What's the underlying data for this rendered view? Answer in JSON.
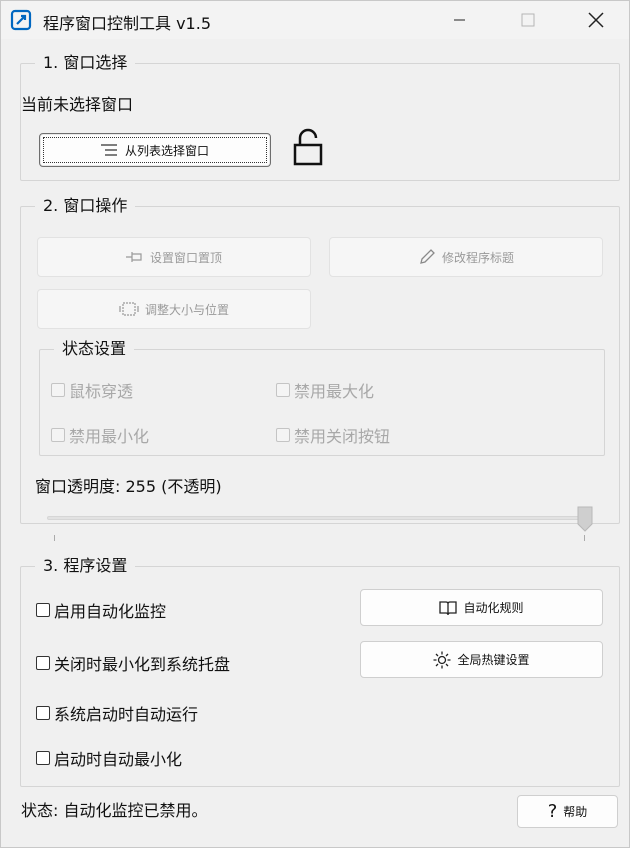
{
  "window": {
    "title": "程序窗口控制工具 v1.5"
  },
  "section1": {
    "title": "1. 窗口选择",
    "current_window": "当前未选择窗口",
    "select_button": "从列表选择窗口"
  },
  "section2": {
    "title": "2. 窗口操作",
    "btn_topmost": "设置窗口置顶",
    "btn_rename": "修改程序标题",
    "btn_resize": "调整大小与位置",
    "state_title": "状态设置",
    "chk_clickthrough": "鼠标穿透",
    "chk_disable_max": "禁用最大化",
    "chk_disable_min": "禁用最小化",
    "chk_disable_close": "禁用关闭按钮",
    "opacity_label": "窗口透明度: 255 (不透明)",
    "opacity_value": 255,
    "opacity_max": 255
  },
  "section3": {
    "title": "3. 程序设置",
    "chk_auto_monitor": "启用自动化监控",
    "chk_min_to_tray": "关闭时最小化到系统托盘",
    "chk_autostart": "系统启动时自动运行",
    "chk_start_min": "启动时自动最小化",
    "btn_rules": "自动化规则",
    "btn_hotkeys": "全局热键设置"
  },
  "status": {
    "text": "状态: 自动化监控已禁用。"
  },
  "help_button": "帮助",
  "colors": {
    "window_bg": "#f0f0f0",
    "disabled_text": "#a8a8a8",
    "accent": "#0067c0"
  }
}
